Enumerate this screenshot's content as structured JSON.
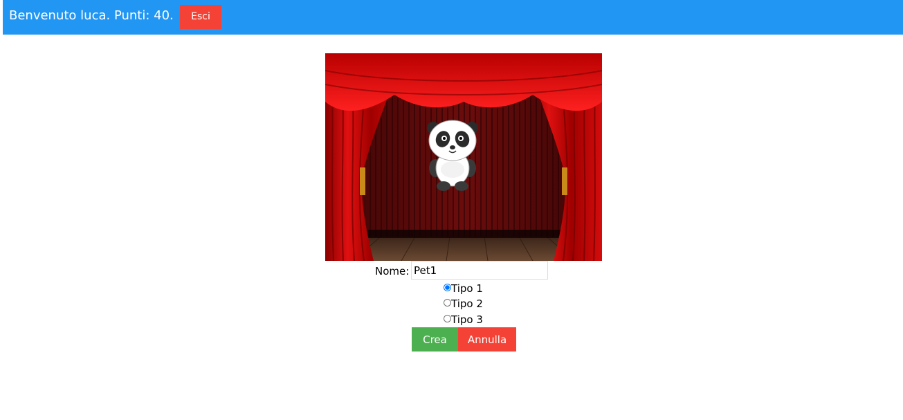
{
  "header": {
    "welcome_text": "Benvenuto luca. Punti: 40.",
    "logout_label": "Esci",
    "background_color": "#2196f3"
  },
  "form": {
    "name_label": "Nome:",
    "name_value": "Pet1",
    "types": [
      {
        "label": "Tipo 1",
        "checked": true
      },
      {
        "label": "Tipo 2",
        "checked": false
      },
      {
        "label": "Tipo 3",
        "checked": false
      }
    ],
    "create_label": "Crea",
    "cancel_label": "Annulla"
  },
  "colors": {
    "create": "#4caf50",
    "cancel": "#f44336"
  },
  "stage": {
    "pet_icon": "panda-icon"
  }
}
